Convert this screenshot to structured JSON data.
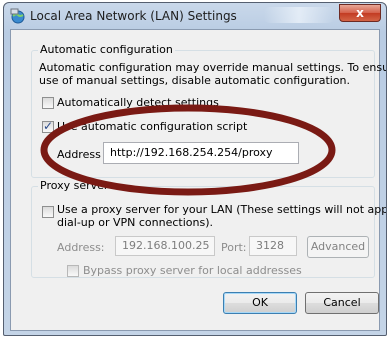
{
  "window": {
    "title": "Local Area Network (LAN) Settings",
    "close_label": "x"
  },
  "auto_config": {
    "group_title": "Automatic configuration",
    "description_line1": "Automatic configuration may override manual settings.  To ensure the",
    "description_line2": "use of manual settings, disable automatic configuration.",
    "auto_detect": {
      "label": "Automatically detect settings",
      "checked": false
    },
    "use_script": {
      "label": "Use automatic configuration script",
      "checked": true
    },
    "address_label": "Address",
    "address_value": "http://192.168.254.254/proxy"
  },
  "proxy": {
    "group_title": "Proxy server",
    "use_proxy_line1": "Use a proxy server for your LAN (These settings will not apply to",
    "use_proxy_line2": "dial-up or VPN connections).",
    "use_proxy_checked": false,
    "address_label": "Address:",
    "address_value": "192.168.100.25",
    "port_label": "Port:",
    "port_value": "3128",
    "advanced_label": "Advanced",
    "bypass_label": "Bypass proxy server for local addresses",
    "bypass_checked": false
  },
  "buttons": {
    "ok": "OK",
    "cancel": "Cancel"
  },
  "colors": {
    "annotation": "#7a1a14",
    "accent": "#3c7fb1"
  }
}
